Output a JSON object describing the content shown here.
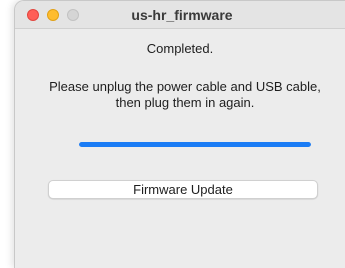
{
  "window": {
    "title": "us-hr_firmware"
  },
  "dialog": {
    "status": "Completed.",
    "message_line1": "Please unplug the power cable and USB cable,",
    "message_line2": "then plug them in again.",
    "progress_fraction": 1.0,
    "button_label": "Firmware Update"
  },
  "colors": {
    "progress_fill": "#1a7cf5",
    "close": "#ff5f57",
    "minimize": "#febc2e",
    "maximize_disabled": "#d5d5d5"
  }
}
